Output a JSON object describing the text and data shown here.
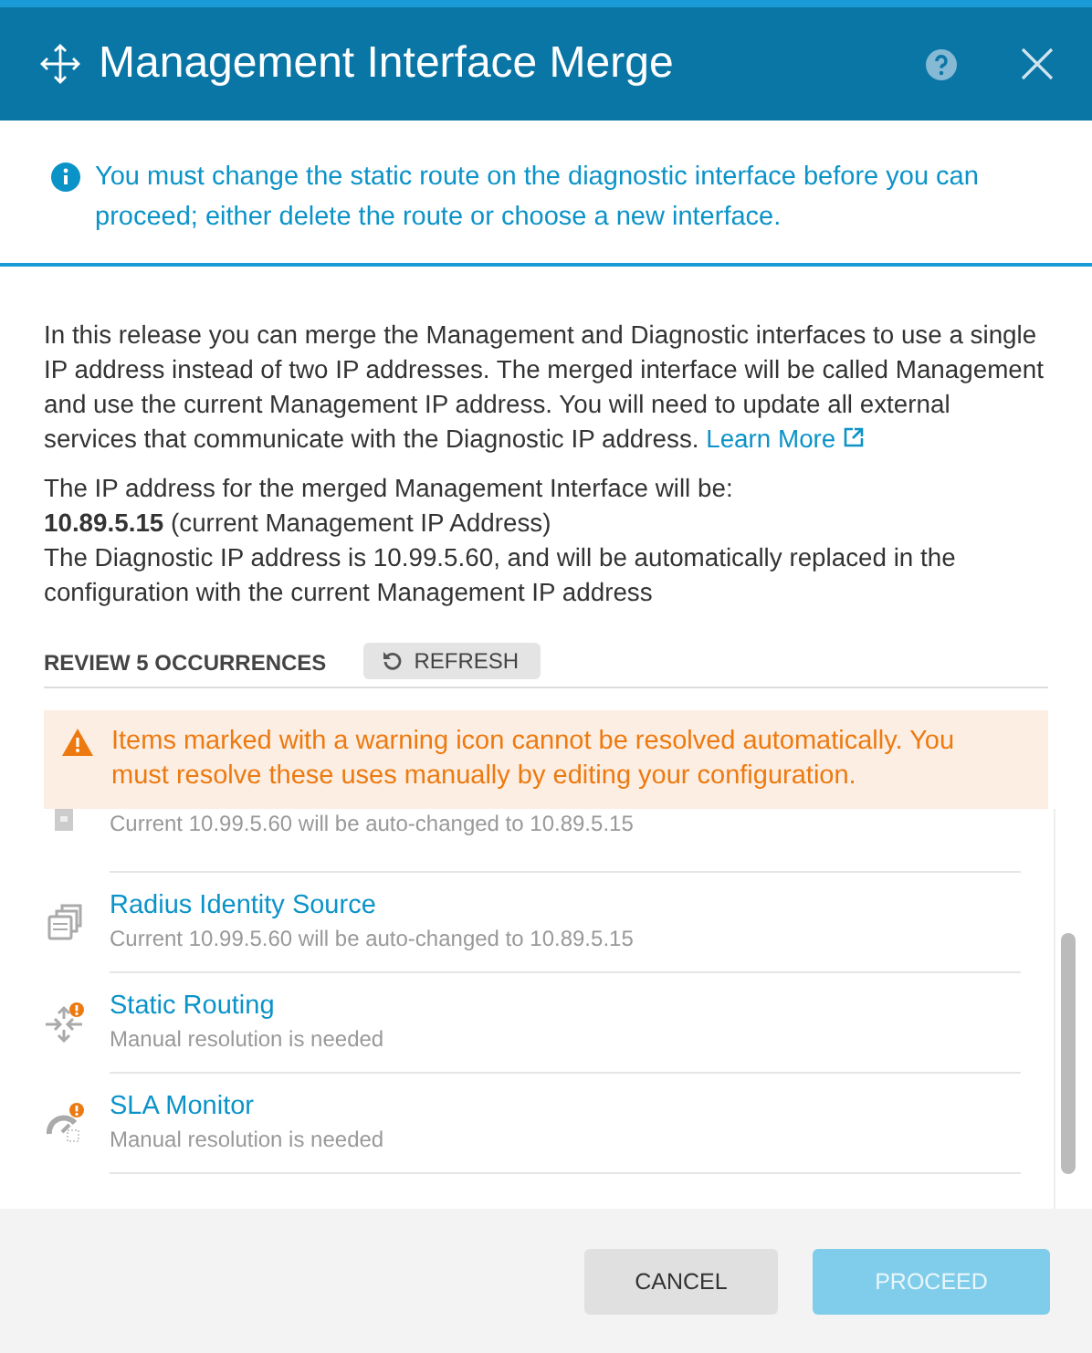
{
  "window": {
    "title": "Management Interface Merge"
  },
  "info_banner": {
    "text": "You must change the static route on the diagnostic interface before you can proceed; either delete the route or choose a new interface."
  },
  "description": {
    "text": "In this release you can merge the Management and Diagnostic interfaces to use a single IP address instead of two IP addresses. The merged interface will be called Management and use the current Management IP address. You will need to update all external services that communicate with the Diagnostic IP address.",
    "link": "Learn More"
  },
  "ip_info": {
    "line_1": "The IP address for the merged Management Interface will be:",
    "address": "**10.89.5.15** (current Management IP Address)",
    "line_3": "The Diagnostic IP address is 10.99.5.60, and will be automatically replaced in the configuration with the current Management IP address"
  },
  "review": {
    "heading": "REVIEW 5 OCCURRENCES",
    "refresh_button": "REFRESH"
  },
  "warning_banner": {
    "text": "Items marked with a warning icon cannot be resolved automatically. You must resolve these uses manually by editing your configuration."
  },
  "occurrences": [
    {
      "kind": "server",
      "subtitle": "Current 10.99.5.60 will be auto-changed to 10.89.5.15"
    },
    {
      "kind": "identity",
      "title": "Radius Identity Source",
      "subtitle": "Current 10.99.5.60 will be auto-changed to 10.89.5.15",
      "warning": false
    },
    {
      "kind": "routing",
      "title": "Static Routing",
      "subtitle": "Manual resolution is needed",
      "warning": true
    },
    {
      "kind": "monitor",
      "title": "SLA Monitor",
      "subtitle": "Manual resolution is needed",
      "warning": true
    }
  ],
  "buttons": [
    {
      "label": "CANCEL",
      "kind": "secondary",
      "disabled": false
    },
    {
      "label": "PROCEED",
      "kind": "primary",
      "disabled": true
    }
  ]
}
